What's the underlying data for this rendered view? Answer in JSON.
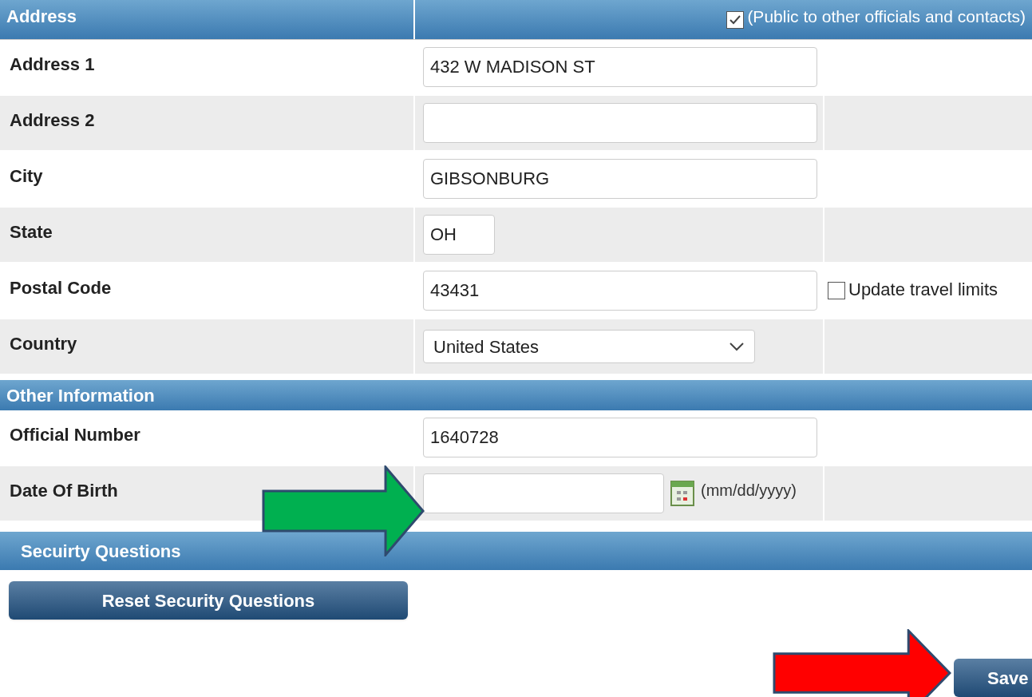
{
  "address_section": {
    "title": "Address",
    "public": {
      "label": "(Public to other officials and contacts)",
      "checked": true
    }
  },
  "address_fields": [
    {
      "label": "Address 1",
      "kind": "text",
      "value": "432 W MADISON ST"
    },
    {
      "label": "Address 2",
      "kind": "text"
    },
    {
      "label": "City",
      "kind": "text",
      "value": "GIBSONBURG"
    },
    {
      "label": "State",
      "kind": "short",
      "value": "OH"
    },
    {
      "label": "Postal Code",
      "kind": "text",
      "value": "43431",
      "option": {
        "label": "Update travel limits",
        "checked": false
      }
    },
    {
      "label": "Country",
      "kind": "select",
      "value": "United States"
    }
  ],
  "other_section": {
    "title": "Other Information"
  },
  "other_fields": [
    {
      "label": "Official Number",
      "kind": "text",
      "value": "1640728"
    },
    {
      "label": "Date Of Birth",
      "kind": "date",
      "hint": "(mm/dd/yyyy)"
    }
  ],
  "security": {
    "title": "Secuirty Questions",
    "button": "Reset Security Questions"
  },
  "save_button": "Save",
  "annotations": [
    {
      "color": "#00b050"
    },
    {
      "color": "#ff0000"
    }
  ]
}
